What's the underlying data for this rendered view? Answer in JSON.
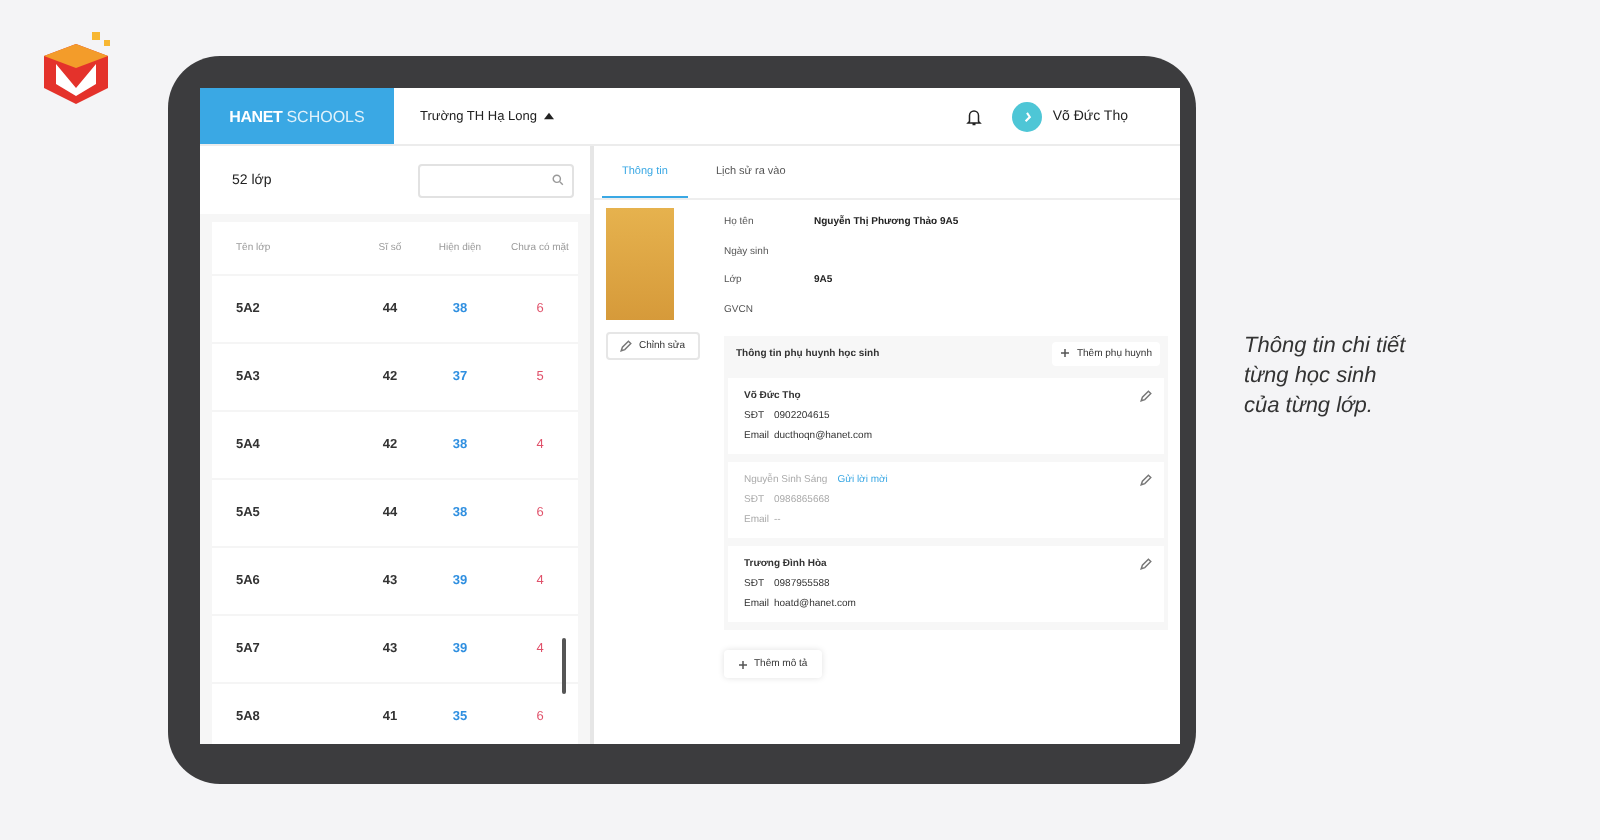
{
  "brand": {
    "name_bold": "HANET",
    "name_light": "SCHOOLS"
  },
  "header": {
    "school": "Trường TH Hạ Long",
    "user_name": "Võ Đức Thọ"
  },
  "class_list": {
    "count": "52 lớp",
    "columns": [
      "Tên lớp",
      "Sĩ số",
      "Hiện diện",
      "Chưa có mặt"
    ],
    "rows": [
      {
        "name": "5A2",
        "total": "44",
        "present": "38",
        "absent": "6"
      },
      {
        "name": "5A3",
        "total": "42",
        "present": "37",
        "absent": "5"
      },
      {
        "name": "5A4",
        "total": "42",
        "present": "38",
        "absent": "4"
      },
      {
        "name": "5A5",
        "total": "44",
        "present": "38",
        "absent": "6"
      },
      {
        "name": "5A6",
        "total": "43",
        "present": "39",
        "absent": "4"
      },
      {
        "name": "5A7",
        "total": "43",
        "present": "39",
        "absent": "4"
      },
      {
        "name": "5A8",
        "total": "41",
        "present": "35",
        "absent": "6"
      }
    ]
  },
  "detail": {
    "tabs": [
      {
        "label": "Thông tin",
        "selected": true
      },
      {
        "label": "Lịch sử ra vào",
        "selected": false
      }
    ],
    "edit_button": "Chỉnh sửa",
    "fields": [
      {
        "label": "Họ tên",
        "value": "Nguyễn Thị Phương Thảo 9A5"
      },
      {
        "label": "Ngày sinh"
      },
      {
        "label": "Lớp",
        "value": "9A5"
      },
      {
        "label": "GVCN"
      }
    ],
    "parents_section": {
      "title": "Thông tin phụ huynh học sinh",
      "add_button": "Thêm phụ huynh",
      "parents": [
        {
          "name": "Võ Đức Thọ",
          "pending": false,
          "phone_label": "SĐT",
          "phone": "0902204615",
          "email_label": "Email",
          "email": "ducthoqn@hanet.com"
        },
        {
          "name": "Nguyễn Sinh Sáng",
          "pending": true,
          "invite_link": "Gửi lời mời",
          "phone_label": "SĐT",
          "phone": "0986865668",
          "email_label": "Email",
          "email": "--"
        },
        {
          "name": "Trương Đình Hòa",
          "pending": false,
          "phone_label": "SĐT",
          "phone": "0987955588",
          "email_label": "Email",
          "email": "hoatd@hanet.com"
        }
      ]
    },
    "add_note_button": "Thêm mô tả"
  },
  "caption": [
    "Thông tin chi tiết",
    "từng học sinh",
    "của từng lớp."
  ]
}
